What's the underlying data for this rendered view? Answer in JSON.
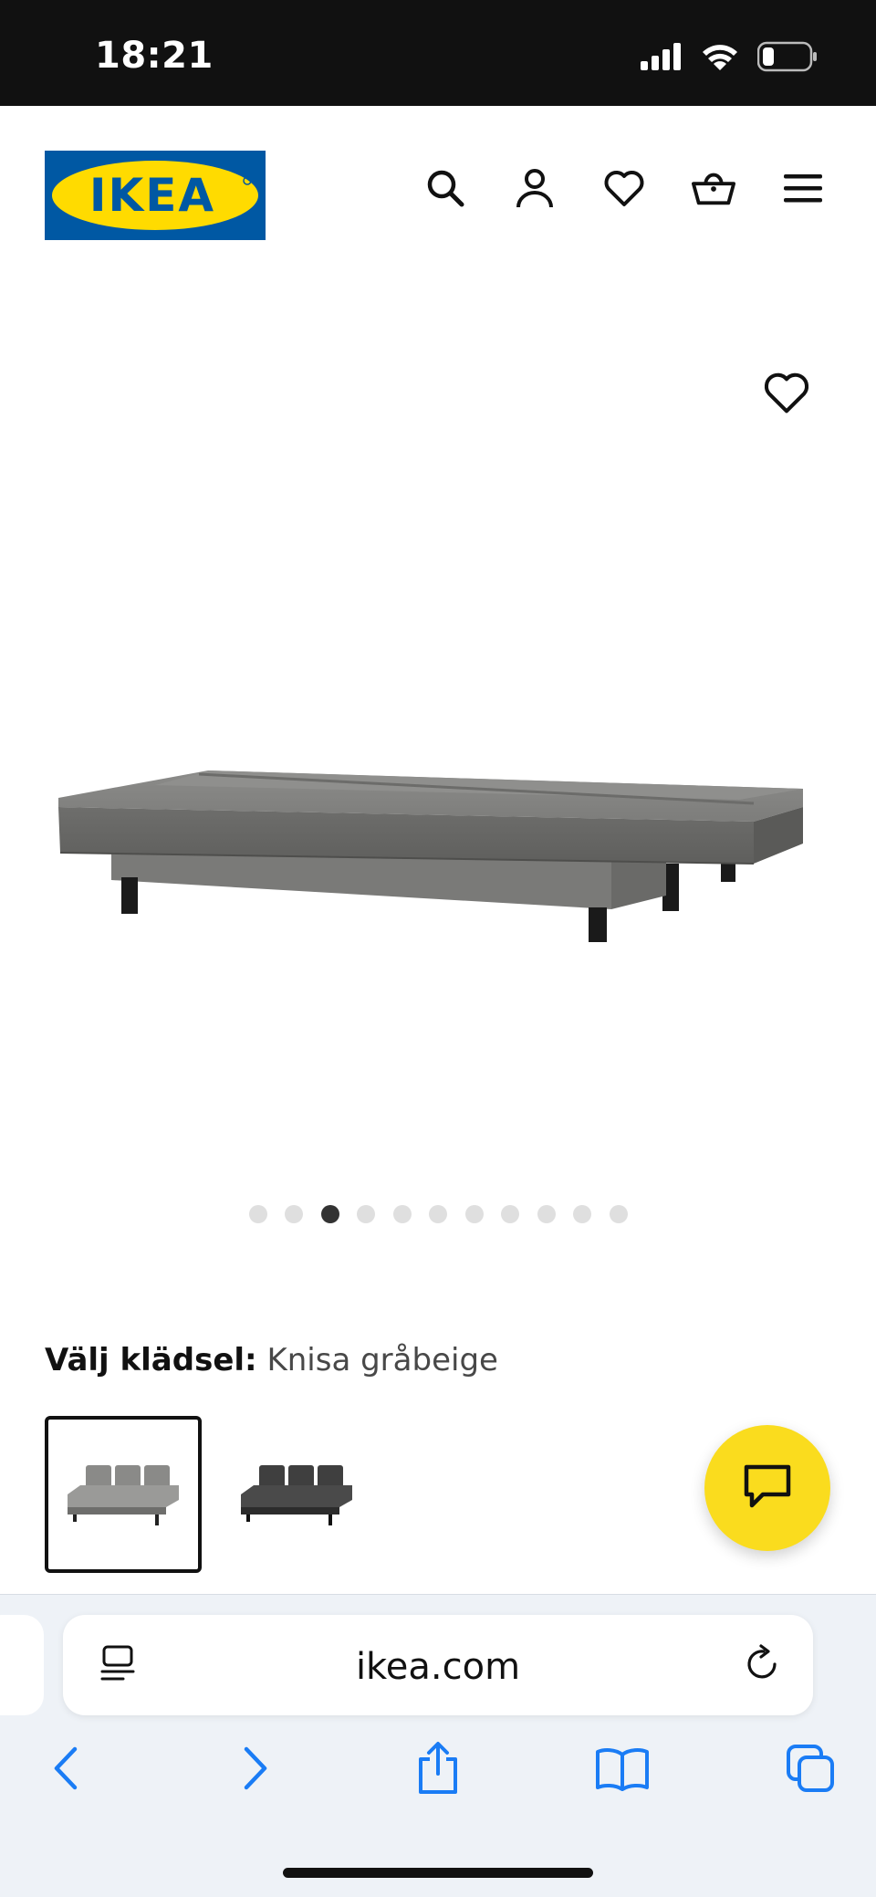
{
  "status_bar": {
    "time": "18:21",
    "icons": [
      "signal-icon",
      "wifi-icon",
      "battery-icon"
    ]
  },
  "header": {
    "logo_text": "IKEA",
    "brand_colors": {
      "blue": "#0058a3",
      "yellow": "#ffdb00"
    },
    "icons": [
      "search-icon",
      "user-icon",
      "heart-icon",
      "basket-icon",
      "menu-icon"
    ]
  },
  "product_image": {
    "favorite_icon": "heart-icon",
    "carousel": {
      "total": 11,
      "active_index": 3
    }
  },
  "upholstery": {
    "label": "Välj klädsel:",
    "value": "Knisa gråbeige",
    "options": [
      {
        "name": "sofa-grey-swatch",
        "color": "#8e8e8e",
        "selected": true
      },
      {
        "name": "sofa-dark-swatch",
        "color": "#3a3a3a",
        "selected": false
      }
    ]
  },
  "chat": {
    "icon": "chat-icon",
    "color": "#fadc1e"
  },
  "browser": {
    "url": "ikea.com",
    "toolbar": [
      "back-icon",
      "forward-icon",
      "share-icon",
      "bookmarks-icon",
      "tabs-icon"
    ],
    "accent": "#1a7cf5"
  }
}
